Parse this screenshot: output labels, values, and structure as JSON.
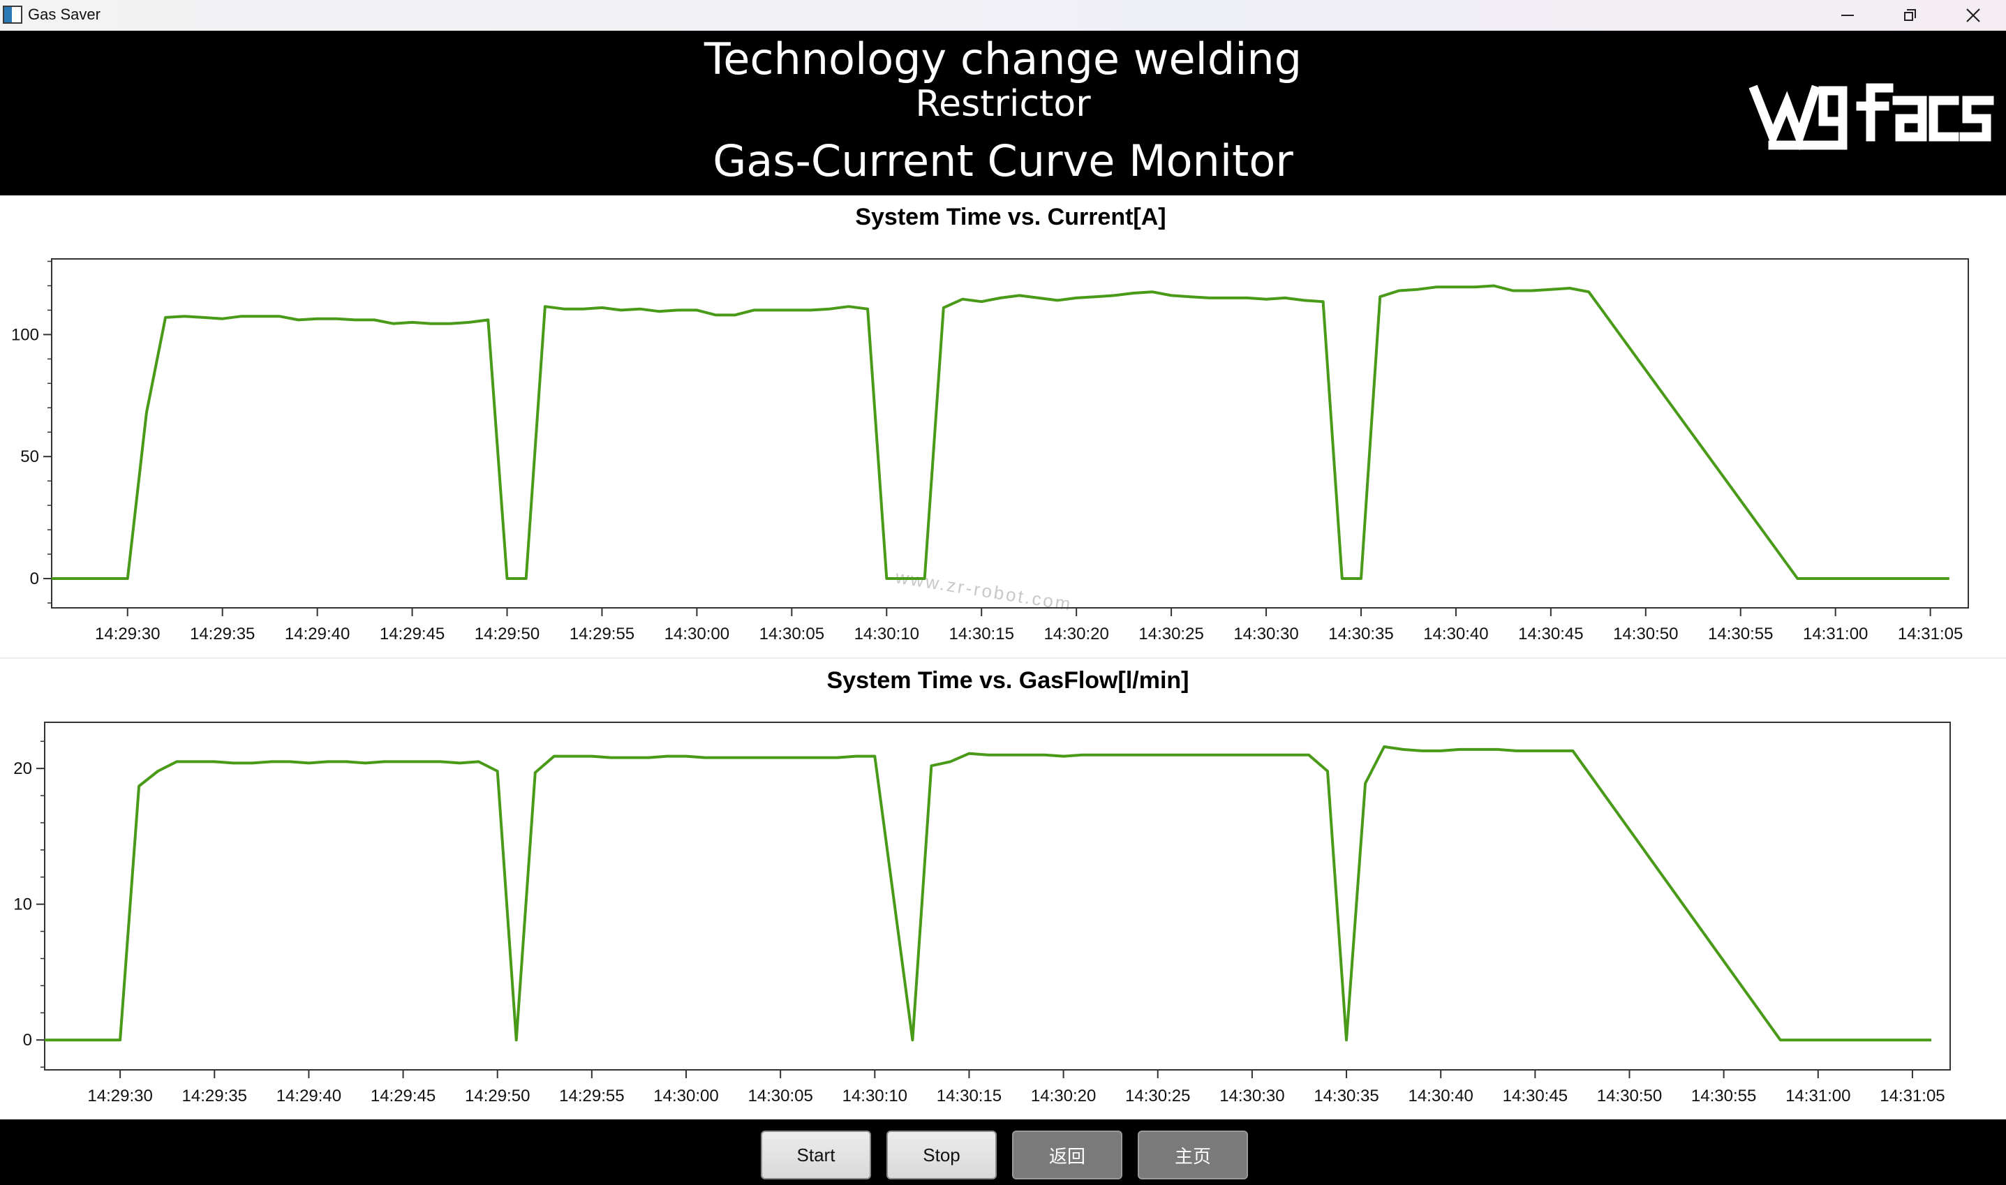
{
  "window": {
    "title": "Gas Saver"
  },
  "header": {
    "title": "Technology change welding",
    "subtitle": "Restrictor",
    "monitor_title": "Gas-Current Curve Monitor",
    "logo_text": "wgfacs"
  },
  "footer": {
    "start_label": "Start",
    "stop_label": "Stop",
    "back_label": "返回",
    "home_label": "主页"
  },
  "colors": {
    "line": "#4a9a19",
    "header_bg": "#000000",
    "footer_bg": "#000000"
  },
  "icons": [
    "app-icon",
    "minimize-icon",
    "restore-icon",
    "close-icon"
  ],
  "chart_data": [
    {
      "type": "line",
      "title": "System Time vs. Current[A]",
      "xlabel": "",
      "ylabel": "",
      "x_ticks": [
        "14:29:30",
        "14:29:35",
        "14:29:40",
        "14:29:45",
        "14:29:50",
        "14:29:55",
        "14:30:00",
        "14:30:05",
        "14:30:10",
        "14:30:15",
        "14:30:20",
        "14:30:25",
        "14:30:30",
        "14:30:35",
        "14:30:40",
        "14:30:45",
        "14:30:50",
        "14:30:55",
        "14:31:00",
        "14:31:05"
      ],
      "y_ticks": [
        0,
        50,
        100
      ],
      "xlim": [
        "14:29:26",
        "14:31:07"
      ],
      "ylim": [
        -12,
        131
      ],
      "grid": false,
      "watermark": "www.zr-robot.com",
      "series": [
        {
          "points": [
            [
              "14:29:26",
              0
            ],
            [
              "14:29:30",
              0
            ],
            [
              "14:29:31",
              68
            ],
            [
              "14:29:32",
              107
            ],
            [
              "14:29:33",
              107.5
            ],
            [
              "14:29:34",
              107
            ],
            [
              "14:29:35",
              106.5
            ],
            [
              "14:29:36",
              107.5
            ],
            [
              "14:29:37",
              107.5
            ],
            [
              "14:29:38",
              107.5
            ],
            [
              "14:29:39",
              106
            ],
            [
              "14:29:40",
              106.5
            ],
            [
              "14:29:41",
              106.5
            ],
            [
              "14:29:42",
              106
            ],
            [
              "14:29:43",
              106
            ],
            [
              "14:29:44",
              104.5
            ],
            [
              "14:29:45",
              105
            ],
            [
              "14:29:46",
              104.5
            ],
            [
              "14:29:47",
              104.5
            ],
            [
              "14:29:48",
              105
            ],
            [
              "14:29:49",
              106
            ],
            [
              "14:29:50",
              0
            ],
            [
              "14:29:51",
              0
            ],
            [
              "14:29:52",
              111.5
            ],
            [
              "14:29:53",
              110.5
            ],
            [
              "14:29:54",
              110.5
            ],
            [
              "14:29:55",
              111
            ],
            [
              "14:29:56",
              110
            ],
            [
              "14:29:57",
              110.5
            ],
            [
              "14:29:58",
              109.5
            ],
            [
              "14:29:59",
              110
            ],
            [
              "14:30:00",
              110
            ],
            [
              "14:30:01",
              108
            ],
            [
              "14:30:02",
              108
            ],
            [
              "14:30:03",
              110
            ],
            [
              "14:30:04",
              110
            ],
            [
              "14:30:05",
              110
            ],
            [
              "14:30:06",
              110
            ],
            [
              "14:30:07",
              110.5
            ],
            [
              "14:30:08",
              111.5
            ],
            [
              "14:30:09",
              110.5
            ],
            [
              "14:30:10",
              0
            ],
            [
              "14:30:12",
              0
            ],
            [
              "14:30:13",
              111
            ],
            [
              "14:30:14",
              114.5
            ],
            [
              "14:30:15",
              113.5
            ],
            [
              "14:30:16",
              115
            ],
            [
              "14:30:17",
              116
            ],
            [
              "14:30:18",
              115
            ],
            [
              "14:30:19",
              114
            ],
            [
              "14:30:20",
              115
            ],
            [
              "14:30:21",
              115.5
            ],
            [
              "14:30:22",
              116
            ],
            [
              "14:30:23",
              117
            ],
            [
              "14:30:24",
              117.5
            ],
            [
              "14:30:25",
              116
            ],
            [
              "14:30:26",
              115.5
            ],
            [
              "14:30:27",
              115
            ],
            [
              "14:30:28",
              115
            ],
            [
              "14:30:29",
              115
            ],
            [
              "14:30:30",
              114.5
            ],
            [
              "14:30:31",
              115
            ],
            [
              "14:30:32",
              114
            ],
            [
              "14:30:33",
              113.5
            ],
            [
              "14:30:34",
              0
            ],
            [
              "14:30:35",
              0
            ],
            [
              "14:30:36",
              115.5
            ],
            [
              "14:30:37",
              118
            ],
            [
              "14:30:38",
              118.5
            ],
            [
              "14:30:39",
              119.5
            ],
            [
              "14:30:40",
              119.5
            ],
            [
              "14:30:41",
              119.5
            ],
            [
              "14:30:42",
              120
            ],
            [
              "14:30:43",
              118
            ],
            [
              "14:30:44",
              118
            ],
            [
              "14:30:45",
              118.5
            ],
            [
              "14:30:46",
              119
            ],
            [
              "14:30:47",
              117.5
            ],
            [
              "14:30:58",
              0
            ],
            [
              "14:31:06",
              0
            ]
          ]
        }
      ]
    },
    {
      "type": "line",
      "title": "System Time vs. GasFlow[l/min]",
      "xlabel": "",
      "ylabel": "",
      "x_ticks": [
        "14:29:30",
        "14:29:35",
        "14:29:40",
        "14:29:45",
        "14:29:50",
        "14:29:55",
        "14:30:00",
        "14:30:05",
        "14:30:10",
        "14:30:15",
        "14:30:20",
        "14:30:25",
        "14:30:30",
        "14:30:35",
        "14:30:40",
        "14:30:45",
        "14:30:50",
        "14:30:55",
        "14:31:00",
        "14:31:05"
      ],
      "y_ticks": [
        0,
        10,
        20
      ],
      "xlim": [
        "14:29:26",
        "14:31:07"
      ],
      "ylim": [
        -2.2,
        23.4
      ],
      "grid": false,
      "series": [
        {
          "points": [
            [
              "14:29:26",
              0
            ],
            [
              "14:29:30",
              0
            ],
            [
              "14:29:31",
              18.7
            ],
            [
              "14:29:32",
              19.8
            ],
            [
              "14:29:33",
              20.5
            ],
            [
              "14:29:34",
              20.5
            ],
            [
              "14:29:35",
              20.5
            ],
            [
              "14:29:36",
              20.4
            ],
            [
              "14:29:37",
              20.4
            ],
            [
              "14:29:38",
              20.5
            ],
            [
              "14:29:39",
              20.5
            ],
            [
              "14:29:40",
              20.4
            ],
            [
              "14:29:41",
              20.5
            ],
            [
              "14:29:42",
              20.5
            ],
            [
              "14:29:43",
              20.4
            ],
            [
              "14:29:44",
              20.5
            ],
            [
              "14:29:45",
              20.5
            ],
            [
              "14:29:46",
              20.5
            ],
            [
              "14:29:47",
              20.5
            ],
            [
              "14:29:48",
              20.4
            ],
            [
              "14:29:49",
              20.5
            ],
            [
              "14:29:50",
              19.8
            ],
            [
              "14:29:51",
              0
            ],
            [
              "14:29:52",
              19.7
            ],
            [
              "14:29:53",
              20.9
            ],
            [
              "14:29:54",
              20.9
            ],
            [
              "14:29:55",
              20.9
            ],
            [
              "14:29:56",
              20.8
            ],
            [
              "14:29:57",
              20.8
            ],
            [
              "14:29:58",
              20.8
            ],
            [
              "14:29:59",
              20.9
            ],
            [
              "14:30:00",
              20.9
            ],
            [
              "14:30:01",
              20.8
            ],
            [
              "14:30:02",
              20.8
            ],
            [
              "14:30:03",
              20.8
            ],
            [
              "14:30:04",
              20.8
            ],
            [
              "14:30:05",
              20.8
            ],
            [
              "14:30:06",
              20.8
            ],
            [
              "14:30:07",
              20.8
            ],
            [
              "14:30:08",
              20.8
            ],
            [
              "14:30:09",
              20.9
            ],
            [
              "14:30:10",
              20.9
            ],
            [
              "14:30:12",
              0
            ],
            [
              "14:30:13",
              20.2
            ],
            [
              "14:30:14",
              20.5
            ],
            [
              "14:30:15",
              21.1
            ],
            [
              "14:30:16",
              21.0
            ],
            [
              "14:30:17",
              21.0
            ],
            [
              "14:30:18",
              21.0
            ],
            [
              "14:30:19",
              21.0
            ],
            [
              "14:30:20",
              20.9
            ],
            [
              "14:30:21",
              21.0
            ],
            [
              "14:30:22",
              21.0
            ],
            [
              "14:30:23",
              21.0
            ],
            [
              "14:30:24",
              21.0
            ],
            [
              "14:30:25",
              21.0
            ],
            [
              "14:30:26",
              21.0
            ],
            [
              "14:30:27",
              21.0
            ],
            [
              "14:30:28",
              21.0
            ],
            [
              "14:30:29",
              21.0
            ],
            [
              "14:30:30",
              21.0
            ],
            [
              "14:30:31",
              21.0
            ],
            [
              "14:30:32",
              21.0
            ],
            [
              "14:30:33",
              21.0
            ],
            [
              "14:30:34",
              19.8
            ],
            [
              "14:30:35",
              0
            ],
            [
              "14:30:36",
              18.9
            ],
            [
              "14:30:37",
              21.6
            ],
            [
              "14:30:38",
              21.4
            ],
            [
              "14:30:39",
              21.3
            ],
            [
              "14:30:40",
              21.3
            ],
            [
              "14:30:41",
              21.4
            ],
            [
              "14:30:42",
              21.4
            ],
            [
              "14:30:43",
              21.4
            ],
            [
              "14:30:44",
              21.3
            ],
            [
              "14:30:45",
              21.3
            ],
            [
              "14:30:46",
              21.3
            ],
            [
              "14:30:47",
              21.3
            ],
            [
              "14:30:58",
              0
            ],
            [
              "14:31:06",
              0
            ]
          ]
        }
      ]
    }
  ]
}
